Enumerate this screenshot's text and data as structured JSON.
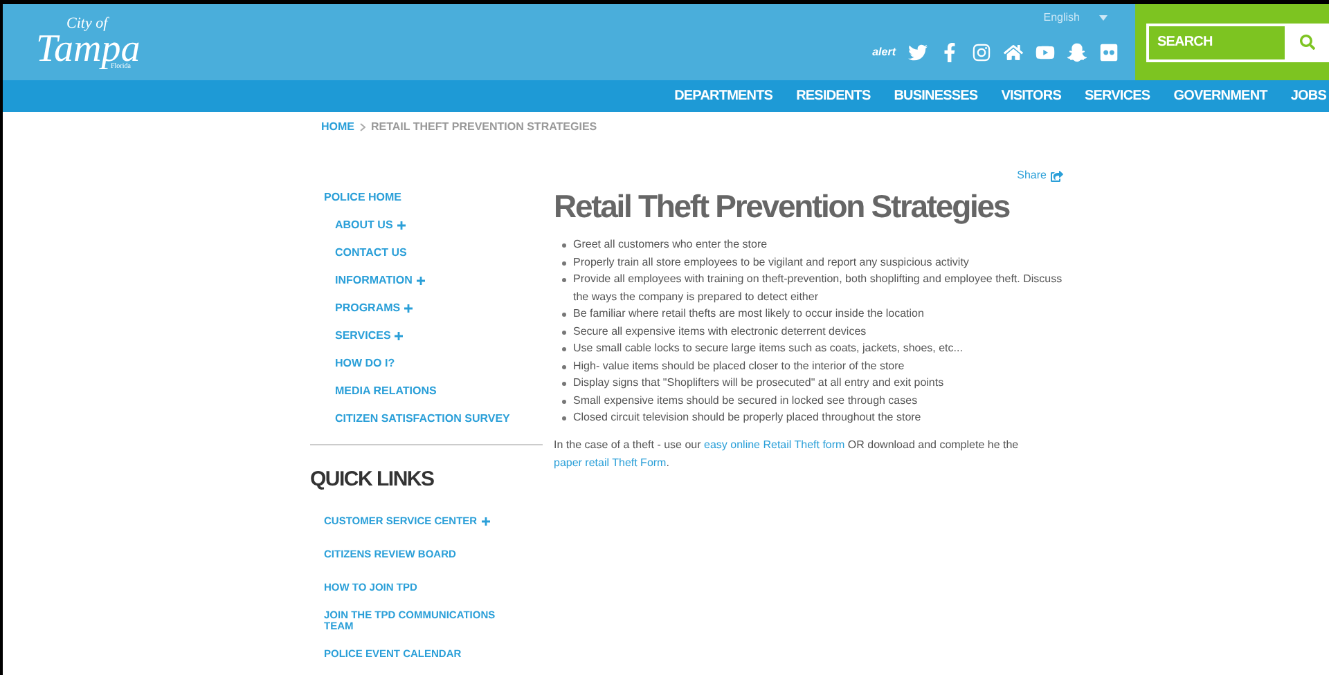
{
  "header": {
    "logo": {
      "top": "City of",
      "main": "Tampa",
      "sub": "Florida"
    },
    "language": "English",
    "social": [
      {
        "kind": "alert",
        "text": "alert"
      },
      {
        "kind": "twitter"
      },
      {
        "kind": "facebook"
      },
      {
        "kind": "instagram"
      },
      {
        "kind": "home"
      },
      {
        "kind": "youtube"
      },
      {
        "kind": "snapchat"
      },
      {
        "kind": "flickr"
      }
    ],
    "search": {
      "placeholder": "SEARCH"
    },
    "nav": [
      "DEPARTMENTS",
      "RESIDENTS",
      "BUSINESSES",
      "VISITORS",
      "SERVICES",
      "GOVERNMENT",
      "JOBS"
    ]
  },
  "breadcrumb": [
    "HOME",
    "RETAIL THEFT PREVENTION STRATEGIES"
  ],
  "sidebar": {
    "items": [
      {
        "label": "POLICE HOME",
        "expandable": false,
        "children": [
          {
            "label": "ABOUT US",
            "expandable": true
          },
          {
            "label": "CONTACT US",
            "expandable": false
          },
          {
            "label": "INFORMATION",
            "expandable": true
          },
          {
            "label": "PROGRAMS",
            "expandable": true
          },
          {
            "label": "SERVICES",
            "expandable": true
          },
          {
            "label": "HOW DO I?",
            "expandable": false
          },
          {
            "label": "MEDIA RELATIONS",
            "expandable": false
          },
          {
            "label": "CITIZEN SATISFACTION SURVEY",
            "expandable": false
          }
        ]
      }
    ],
    "quick_links": {
      "title": "QUICK LINKS",
      "items": [
        {
          "label": "CUSTOMER SERVICE CENTER",
          "expandable": true
        },
        {
          "label": "CITIZENS REVIEW BOARD",
          "expandable": false
        },
        {
          "label": "HOW TO JOIN TPD",
          "expandable": false
        },
        {
          "label": "JOIN THE TPD COMMUNICATIONS TEAM",
          "expandable": false
        },
        {
          "label": "POLICE EVENT CALENDAR",
          "expandable": false
        }
      ]
    }
  },
  "content": {
    "share": "Share",
    "title": "Retail Theft Prevention Strategies",
    "bullets": [
      "Greet all customers who enter the store",
      "Properly train all store employees to be vigilant and report any suspicious activity",
      "Provide all employees with training on theft-prevention, both shoplifting and employee theft. Discuss the ways the company is prepared to detect either",
      "Be familiar where retail thefts are most likely to occur inside the location",
      "Secure all expensive items with electronic deterrent devices",
      "Use small cable locks to secure large items such as coats, jackets, shoes, etc...",
      "High- value items should be placed closer to the interior of the store",
      "Display signs that \"Shoplifters will be prosecuted\" at all entry and exit points",
      "Small expensive items should be secured in locked see through cases",
      "Closed circuit television should be properly placed throughout the store"
    ],
    "paragraph": [
      {
        "kind": "text",
        "text": "In the case of a theft - use our "
      },
      {
        "kind": "link",
        "text": "easy online Retail Theft form"
      },
      {
        "kind": "text",
        "text": "  OR download and complete  he the "
      },
      {
        "kind": "link",
        "text": "paper retail Theft Form"
      },
      {
        "kind": "text",
        "text": "."
      }
    ]
  }
}
